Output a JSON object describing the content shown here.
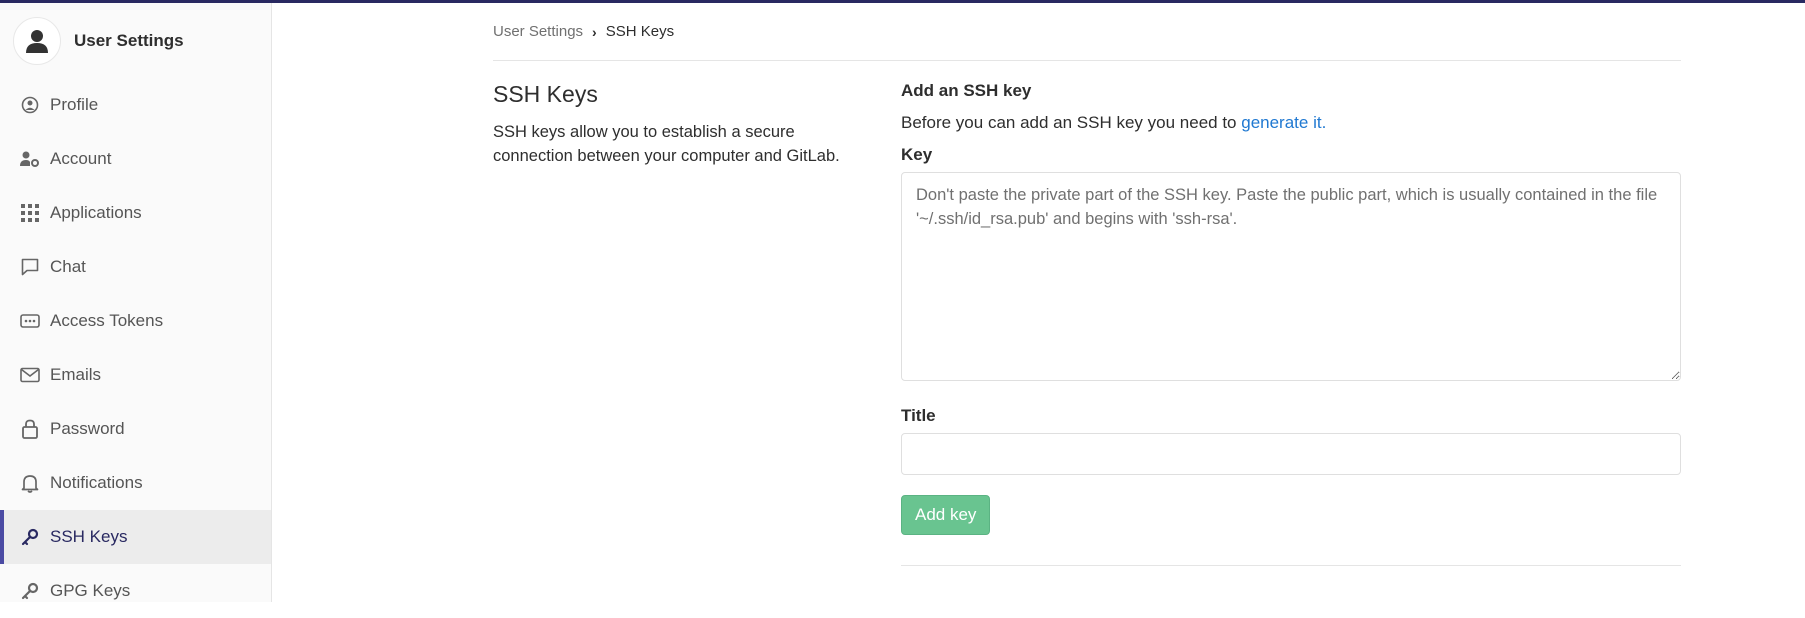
{
  "sidebar": {
    "title": "User Settings",
    "items": [
      {
        "label": "Profile",
        "icon": "profile-icon"
      },
      {
        "label": "Account",
        "icon": "account-gear-icon"
      },
      {
        "label": "Applications",
        "icon": "applications-grid-icon"
      },
      {
        "label": "Chat",
        "icon": "chat-icon"
      },
      {
        "label": "Access Tokens",
        "icon": "token-icon"
      },
      {
        "label": "Emails",
        "icon": "mail-icon"
      },
      {
        "label": "Password",
        "icon": "lock-icon"
      },
      {
        "label": "Notifications",
        "icon": "bell-icon"
      },
      {
        "label": "SSH Keys",
        "icon": "key-icon",
        "active": true
      },
      {
        "label": "GPG Keys",
        "icon": "key-icon"
      }
    ]
  },
  "breadcrumb": {
    "parent": "User Settings",
    "current": "SSH Keys"
  },
  "section": {
    "title": "SSH Keys",
    "description": "SSH keys allow you to establish a secure connection between your computer and GitLab."
  },
  "form": {
    "heading": "Add an SSH key",
    "intro_text": "Before you can add an SSH key you need to ",
    "intro_link": "generate it.",
    "key_label": "Key",
    "key_placeholder": "Don't paste the private part of the SSH key. Paste the public part, which is usually contained in the file '~/.ssh/id_rsa.pub' and begins with 'ssh-rsa'.",
    "key_value": "",
    "title_label": "Title",
    "title_value": "",
    "submit_label": "Add key"
  },
  "colors": {
    "accent": "#4b4ba3",
    "topbar": "#292961",
    "link": "#1f78d1",
    "success": "#69c490"
  }
}
